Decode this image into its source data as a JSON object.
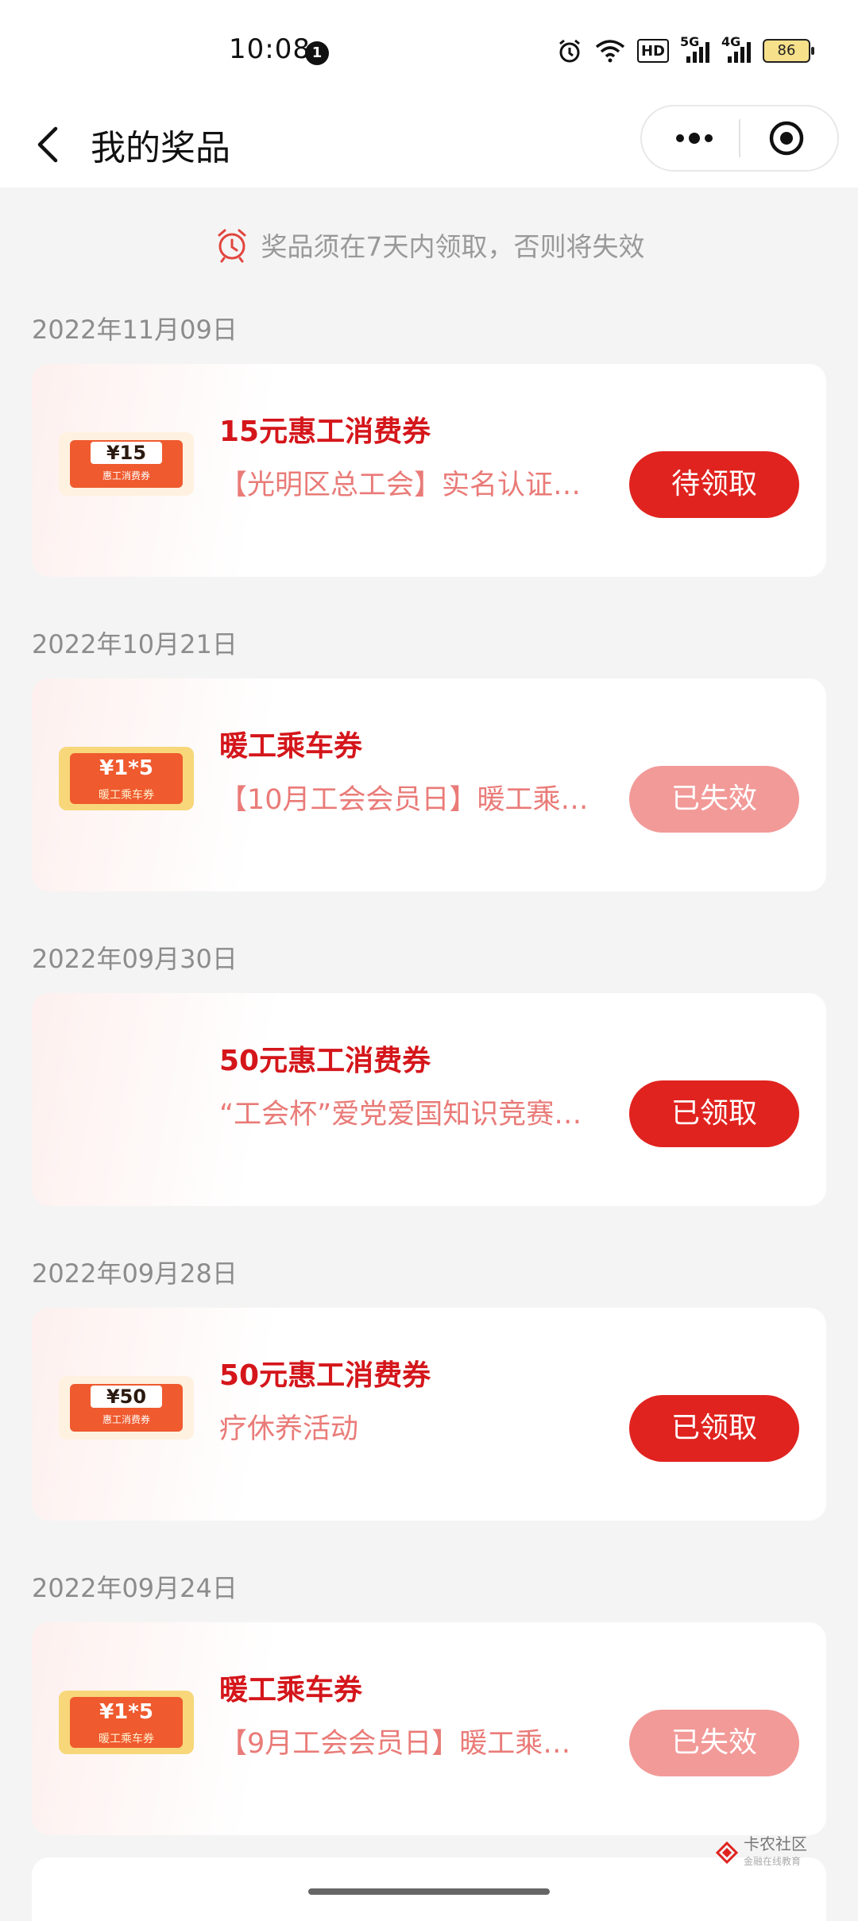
{
  "status_bar": {
    "time": "10:08",
    "notification_count": "1",
    "hd_label": "HD",
    "signal_5g": "5G",
    "signal_4g": "4G",
    "battery": "86"
  },
  "nav": {
    "title": "我的奖品"
  },
  "notice": "奖品须在7天内领取，否则将失效",
  "groups": [
    {
      "date": "2022年11月09日",
      "thumb": {
        "style": "orange",
        "amount": "¥15",
        "subtitle": "惠工消费券"
      },
      "title": "15元惠工消费券",
      "description": "【光明区总工会】实名认证…",
      "status": "待领取"
    },
    {
      "date": "2022年10月21日",
      "thumb": {
        "style": "yellow",
        "amount": "¥1*5",
        "subtitle": "暖工乘车券"
      },
      "title": "暖工乘车券",
      "description": "【10月工会会员日】暖工乘…",
      "status": "已失效"
    },
    {
      "date": "2022年09月30日",
      "thumb": null,
      "title": "50元惠工消费券",
      "description": "“工会杯”爱党爱国知识竞赛…",
      "status": "已领取"
    },
    {
      "date": "2022年09月28日",
      "thumb": {
        "style": "orange",
        "amount": "¥50",
        "subtitle": "惠工消费券"
      },
      "title": "50元惠工消费券",
      "description": "疗休养活动",
      "status": "已领取"
    },
    {
      "date": "2022年09月24日",
      "thumb": {
        "style": "yellow",
        "amount": "¥1*5",
        "subtitle": "暖工乘车券"
      },
      "title": "暖工乘车券",
      "description": "【9月工会会员日】暖工乘…",
      "status": "已失效"
    }
  ],
  "watermark": {
    "name": "卡农社区",
    "tagline": "金融在线教育"
  }
}
